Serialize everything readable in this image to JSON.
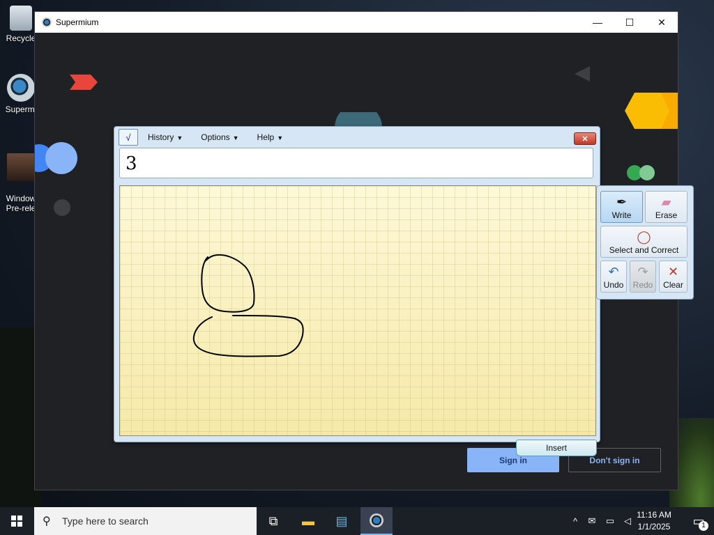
{
  "desktop": {
    "icons": [
      {
        "label": "Recycle"
      },
      {
        "label": "Supermi"
      },
      {
        "label": "Window\nPre-rele"
      }
    ]
  },
  "window": {
    "title": "Supermium",
    "buttons": {
      "minimize": "—",
      "maximize": "☐",
      "close": "✕"
    },
    "signin_label": "Sign in",
    "nosignin_label": "Don't sign in"
  },
  "tip": {
    "menu": [
      {
        "label": "History"
      },
      {
        "label": "Options"
      },
      {
        "label": "Help"
      }
    ],
    "close_glyph": "✕",
    "input_value": "3",
    "tools": {
      "write": "Write",
      "erase": "Erase",
      "select_correct": "Select and Correct",
      "undo": "Undo",
      "redo": "Redo",
      "clear": "Clear"
    },
    "insert_label": "Insert"
  },
  "taskbar": {
    "search_placeholder": "Type here to search",
    "time": "11:16 AM",
    "date": "1/1/2025",
    "notification_count": "1"
  },
  "colors": {
    "accent_blue": "#8ab4f8",
    "window_bg": "#202124",
    "taskbar_bg": "#1b1f26"
  }
}
